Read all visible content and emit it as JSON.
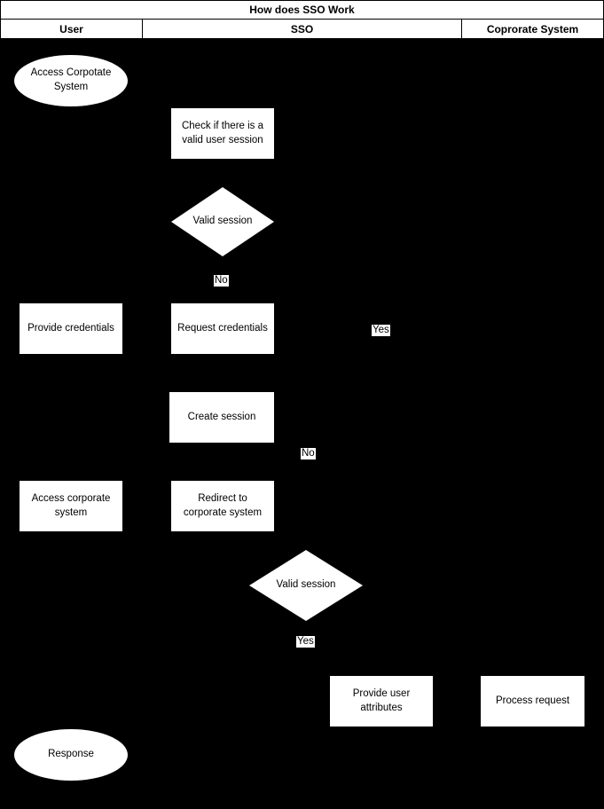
{
  "diagram": {
    "title": "How does SSO Work",
    "lanes": [
      {
        "id": "user",
        "label": "User"
      },
      {
        "id": "sso",
        "label": "SSO"
      },
      {
        "id": "corp",
        "label": "Coprorate System"
      }
    ],
    "nodes": [
      {
        "id": "access-corporate-system-start",
        "type": "ellipse",
        "lane": "user",
        "label": "Access Corpotate System"
      },
      {
        "id": "check-valid-user-session",
        "type": "process",
        "lane": "sso",
        "label": "Check if there is a valid user session"
      },
      {
        "id": "valid-session-decision-1",
        "type": "decision",
        "lane": "sso",
        "label": "Valid session"
      },
      {
        "id": "provide-credentials",
        "type": "process",
        "lane": "user",
        "label": "Provide credentials"
      },
      {
        "id": "request-credentials",
        "type": "process",
        "lane": "sso",
        "label": "Request credentials"
      },
      {
        "id": "create-session",
        "type": "process",
        "lane": "sso",
        "label": "Create session"
      },
      {
        "id": "access-corporate-system",
        "type": "process",
        "lane": "user",
        "label": "Access corporate system"
      },
      {
        "id": "redirect-to-corporate-system",
        "type": "process",
        "lane": "sso",
        "label": "Redirect to corporate system"
      },
      {
        "id": "valid-session-decision-2",
        "type": "decision",
        "lane": "sso",
        "label": "Valid session"
      },
      {
        "id": "provide-user-attributes",
        "type": "process",
        "lane": "sso",
        "label": "Provide user attributes"
      },
      {
        "id": "process-request",
        "type": "process",
        "lane": "corp",
        "label": "Process request"
      },
      {
        "id": "response-end",
        "type": "ellipse",
        "lane": "user",
        "label": "Response"
      }
    ],
    "edge_labels": [
      {
        "id": "decision-1-no",
        "text": "No"
      },
      {
        "id": "decision-1-yes",
        "text": "Yes"
      },
      {
        "id": "create-session-no",
        "text": "No"
      },
      {
        "id": "decision-2-yes",
        "text": "Yes"
      }
    ],
    "colors": {
      "background": "#000000",
      "shape_fill": "#ffffff",
      "stroke": "#000000",
      "text": "#000000"
    }
  }
}
